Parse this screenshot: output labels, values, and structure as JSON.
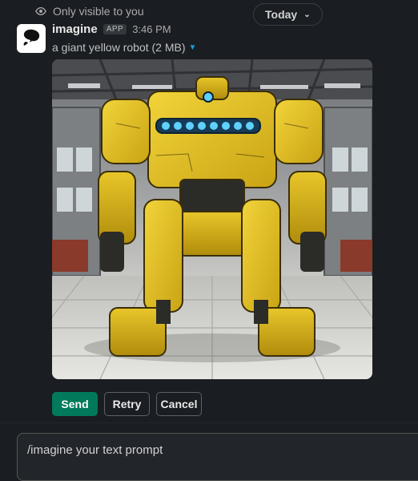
{
  "visibility": {
    "icon": "eye-icon",
    "text": "Only visible to you"
  },
  "date_divider": {
    "label": "Today",
    "icon": "chevron-down-icon"
  },
  "message": {
    "avatar_icon": "speech-bubble-icon",
    "app_name": "imagine",
    "badge": "APP",
    "time": "3:46 PM",
    "file_label": "a giant yellow robot (2 MB)",
    "file_caret_icon": "caret-down-icon",
    "image_subject": "yellow-robot-image"
  },
  "actions": {
    "send": "Send",
    "retry": "Retry",
    "cancel": "Cancel"
  },
  "composer": {
    "value": "/imagine your text prompt"
  },
  "colors": {
    "send_green": "#007a5a",
    "background": "#1a1d21",
    "link_blue": "#1d9bd1"
  }
}
